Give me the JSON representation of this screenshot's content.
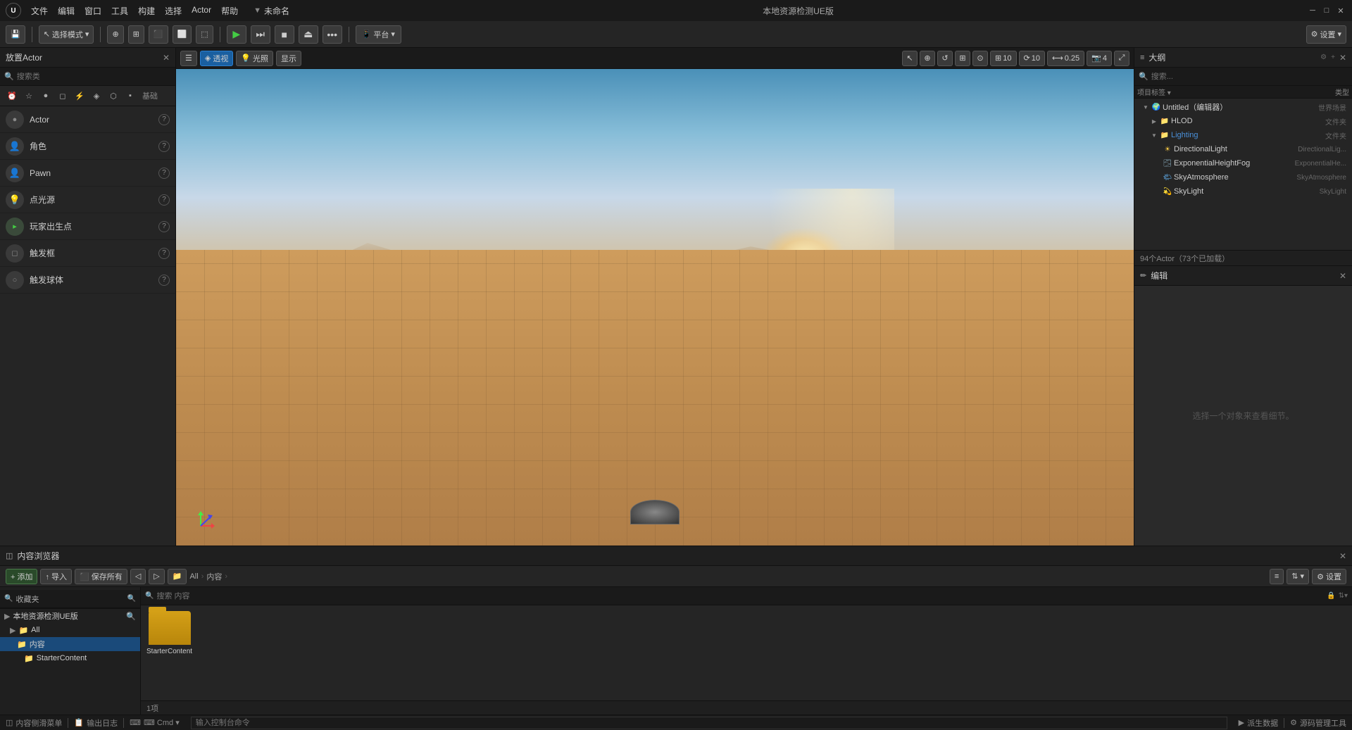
{
  "titlebar": {
    "logo_text": "U",
    "menus": [
      "文件",
      "编辑",
      "窗口",
      "工具",
      "构建",
      "选择",
      "Actor",
      "帮助"
    ],
    "title": "本地资源检测UE版",
    "project_name": "未命名",
    "win_minimize": "─",
    "win_restore": "□",
    "win_close": "✕"
  },
  "toolbar": {
    "select_mode": "选择模式",
    "transform_btn": "+",
    "play_btn": "▶",
    "skip_btn": "⏭",
    "stop_btn": "■",
    "eject_btn": "⏏",
    "more_btn": "•••",
    "platform_btn": "平台",
    "settings_btn": "设置",
    "settings_label": "⚙ 设置 ▾"
  },
  "place_actor": {
    "panel_title": "放置Actor",
    "search_placeholder": "搜索类",
    "tabs": [
      "⏰",
      "☆",
      "●",
      "◻",
      "⚡",
      "◈",
      "⬡",
      "▪"
    ],
    "tab_label": "基础",
    "actors": [
      {
        "name": "Actor",
        "icon": "●"
      },
      {
        "name": "角色",
        "icon": "👤"
      },
      {
        "name": "Pawn",
        "icon": "👤"
      },
      {
        "name": "点光源",
        "icon": "💡"
      },
      {
        "name": "玩家出生点",
        "icon": "🏁"
      },
      {
        "name": "触发框",
        "icon": "◻"
      },
      {
        "name": "触发球体",
        "icon": "○"
      }
    ]
  },
  "viewport": {
    "toolbar": {
      "menu_btn": "☰",
      "perspective_btn": "透视",
      "lighting_btn": "光照",
      "show_btn": "显示",
      "nav_btn": "▶",
      "transform_btns": [
        "↔",
        "↺",
        "⟷"
      ],
      "grid_icon": "⊞",
      "grid_value": "10",
      "angle_icon": "⟳",
      "angle_value": "10",
      "scale_icon": "⟷",
      "scale_value": "0.25",
      "cam_icon": "📷",
      "cam_value": "4",
      "expand_icon": "⤢"
    }
  },
  "outliner": {
    "panel_title": "大纲",
    "search_placeholder": "搜索...",
    "tree": [
      {
        "level": 0,
        "arrow": "▼",
        "icon": "🌍",
        "label": "Untitled（编辑器）",
        "type": "世界场景",
        "expanded": true
      },
      {
        "level": 1,
        "arrow": "▶",
        "icon": "📁",
        "label": "HLOD",
        "type": "文件夹",
        "expanded": false
      },
      {
        "level": 1,
        "arrow": "▼",
        "icon": "📁",
        "label": "Lighting",
        "type": "文件夹",
        "expanded": true,
        "color": "#4a90d9"
      },
      {
        "level": 2,
        "arrow": " ",
        "icon": "☀",
        "label": "DirectionalLight",
        "type": "DirectionalLig...",
        "expanded": false
      },
      {
        "level": 2,
        "arrow": " ",
        "icon": "🌫",
        "label": "ExponentialHeightFog",
        "type": "ExponentialHe...",
        "expanded": false
      },
      {
        "level": 2,
        "arrow": " ",
        "icon": "🌤",
        "label": "SkyAtmosphere",
        "type": "SkyAtmosphere",
        "expanded": false
      },
      {
        "level": 2,
        "arrow": " ",
        "icon": "🌙",
        "label": "SkyLight",
        "type": "SkyLight",
        "expanded": false
      }
    ],
    "footer": "94个Actor（73个已加载）"
  },
  "editor": {
    "panel_title": "编辑",
    "hint": "选择一个对象来查看细节。"
  },
  "content_browser": {
    "panel_title": "内容浏览器",
    "add_btn": "+ 添加",
    "import_btn": "↑ 导入",
    "save_btn": "⬛ 保存所有",
    "search_placeholder": "搜索 内容",
    "breadcrumb": [
      "All",
      "内容"
    ],
    "count": "1项",
    "sidebar": {
      "items": [
        {
          "label": "收藏夹",
          "level": 0,
          "arrow": "▶",
          "icon": ""
        },
        {
          "label": "本地资源检测UE版",
          "level": 0,
          "arrow": "▶",
          "icon": ""
        },
        {
          "label": "All",
          "level": 1,
          "arrow": "▶",
          "icon": "📁",
          "active": false
        },
        {
          "label": "内容",
          "level": 2,
          "arrow": " ",
          "icon": "📁",
          "active": true
        },
        {
          "label": "StarterContent",
          "level": 3,
          "arrow": " ",
          "icon": "📁",
          "active": false
        }
      ]
    },
    "folders": [
      {
        "name": "StarterContent"
      }
    ],
    "settings_btn": "⚙ 设置"
  },
  "status_bar": {
    "content_browser": "内容侧滑菜单",
    "output_log": "输出日志",
    "cmd_label": "⌨ Cmd ▾",
    "cmd_placeholder": "输入控制台命令",
    "derive_data": "派生数据",
    "source_control": "源码管理工具"
  }
}
